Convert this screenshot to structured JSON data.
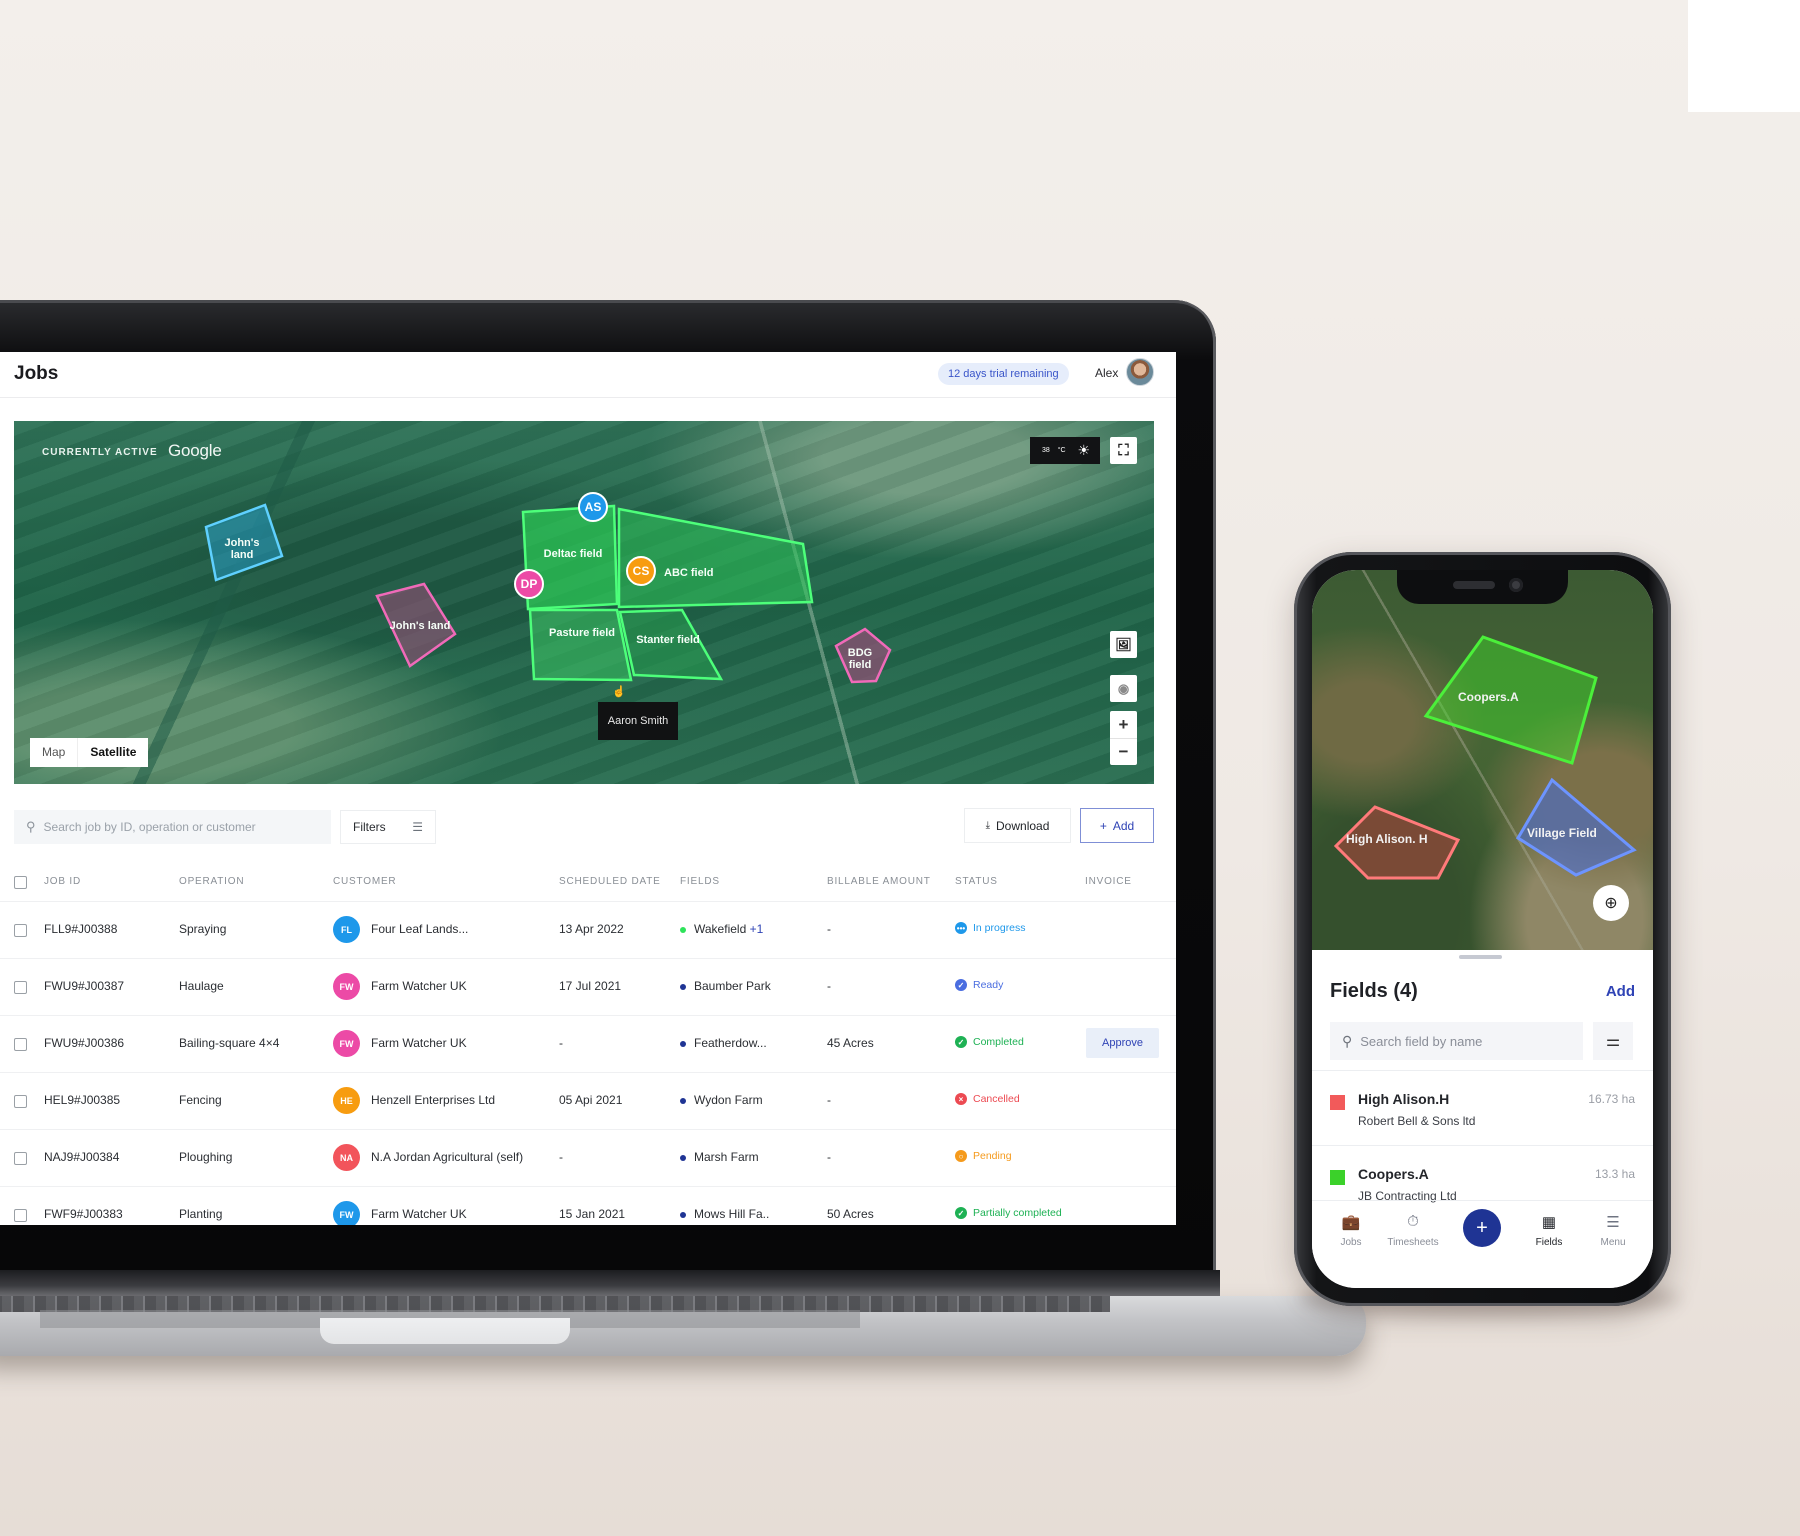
{
  "laptop": {
    "header": {
      "title": "Jobs",
      "trial_badge": "12 days trial remaining",
      "user_name": "Alex"
    },
    "map": {
      "status_label": "CURRENTLY ACTIVE",
      "provider_label": "Google",
      "weather": {
        "temperature": "38",
        "unit": "°C",
        "icon": "sun-icon"
      },
      "map_types": [
        "Map",
        "Satellite"
      ],
      "selected_map_type": "Satellite",
      "fields": [
        {
          "name": "John's land",
          "color": "#29a8e0",
          "label_lines": [
            "John's",
            "land"
          ]
        },
        {
          "name": "John's land",
          "color": "#e0479c",
          "label_lines": [
            "John's land"
          ]
        },
        {
          "name": "Deltac field",
          "color": "#2ee35a",
          "label_lines": [
            "Deltac field"
          ]
        },
        {
          "name": "ABC field",
          "color": "#2ee35a",
          "label_lines": [
            "ABC field"
          ]
        },
        {
          "name": "Pasture field",
          "color": "#2ee35a",
          "label_lines": [
            "Pasture field"
          ]
        },
        {
          "name": "Stanter field",
          "color": "#2ee35a",
          "label_lines": [
            "Stanter field"
          ]
        },
        {
          "name": "BDG field",
          "color": "#e0479c",
          "label_lines": [
            "BDG",
            "field"
          ]
        }
      ],
      "markers": [
        {
          "initials": "AS",
          "color": "#1e98ea"
        },
        {
          "initials": "DP",
          "color": "#ec4aa6"
        },
        {
          "initials": "CS",
          "color": "#f79c10"
        }
      ],
      "tooltip": "Aaron Smith",
      "controls": {
        "zoom_in": "+",
        "zoom_out": "−"
      }
    },
    "toolbar": {
      "search_placeholder": "Search job by ID, operation or customer",
      "filters_label": "Filters",
      "download_label": "Download",
      "add_label": "Add"
    },
    "table": {
      "columns": [
        "JOB ID",
        "OPERATION",
        "CUSTOMER",
        "SCHEDULED DATE",
        "FIELDS",
        "BILLABLE AMOUNT",
        "STATUS",
        "INVOICE"
      ],
      "rows": [
        {
          "job_id": "FLL9#J00388",
          "operation": "Spraying",
          "customer_initials": "FL",
          "customer_color": "#1e98ea",
          "customer": "Four Leaf Lands...",
          "date": "13 Apr 2022",
          "field": "Wakefield",
          "field_extra": "+1",
          "field_dot": "#2ee35a",
          "billable": "-",
          "status": "In progress",
          "status_color": "#1e98ea",
          "status_icon": "•••",
          "invoice": ""
        },
        {
          "job_id": "FWU9#J00387",
          "operation": "Haulage",
          "customer_initials": "FW",
          "customer_color": "#ec4aa6",
          "customer": "Farm Watcher UK",
          "date": "17 Jul 2021",
          "field": "Baumber Park",
          "field_extra": "",
          "field_dot": "#1f3494",
          "billable": "-",
          "status": "Ready",
          "status_color": "#4a6de0",
          "status_icon": "✓",
          "invoice": ""
        },
        {
          "job_id": "FWU9#J00386",
          "operation": "Bailing-square 4×4",
          "customer_initials": "FW",
          "customer_color": "#ec4aa6",
          "customer": "Farm Watcher UK",
          "date": "-",
          "field": "Featherdow...",
          "field_extra": "",
          "field_dot": "#1f3494",
          "billable": "45 Acres",
          "status": "Completed",
          "status_color": "#1eb154",
          "status_icon": "✓",
          "invoice": "Approve"
        },
        {
          "job_id": "HEL9#J00385",
          "operation": "Fencing",
          "customer_initials": "HE",
          "customer_color": "#f79c10",
          "customer": "Henzell Enterprises Ltd",
          "date": "05 Api 2021",
          "field": "Wydon Farm",
          "field_extra": "",
          "field_dot": "#1f3494",
          "billable": "-",
          "status": "Cancelled",
          "status_color": "#ec4a52",
          "status_icon": "×",
          "invoice": ""
        },
        {
          "job_id": "NAJ9#J00384",
          "operation": "Ploughing",
          "customer_initials": "NA",
          "customer_color": "#f2545b",
          "customer": "N.A Jordan Agricultural (self)",
          "date": "-",
          "field": "Marsh Farm",
          "field_extra": "",
          "field_dot": "#1f3494",
          "billable": "-",
          "status": "Pending",
          "status_color": "#f59a1c",
          "status_icon": "○",
          "invoice": ""
        },
        {
          "job_id": "FWF9#J00383",
          "operation": "Planting",
          "customer_initials": "FW",
          "customer_color": "#1e98ea",
          "customer": "Farm Watcher UK",
          "date": "15 Jan 2021",
          "field": "Mows Hill Fa..",
          "field_extra": "",
          "field_dot": "#1f3494",
          "billable": "50 Acres",
          "status": "Partially completed",
          "status_color": "#1eb154",
          "status_icon": "✓",
          "invoice": ""
        }
      ]
    }
  },
  "phone": {
    "map_fields": [
      {
        "name": "Coopers.A",
        "color": "#3fe02a"
      },
      {
        "name": "High Alison. H",
        "color": "#f25a5a"
      },
      {
        "name": "Village Field",
        "color": "#3d6cf0"
      }
    ],
    "sheet": {
      "title": "Fields (4)",
      "add_label": "Add",
      "search_placeholder": "Search field by name",
      "fields": [
        {
          "name": "High Alison.H",
          "owner": "Robert Bell & Sons ltd",
          "area": "16.73 ha",
          "color": "#f25a5a"
        },
        {
          "name": "Coopers.A",
          "owner": "JB Contracting Ltd",
          "area": "13.3 ha",
          "color": "#3bd12a"
        }
      ]
    },
    "tabs": [
      {
        "label": "Jobs",
        "icon": "briefcase-icon",
        "active": false
      },
      {
        "label": "Timesheets",
        "icon": "stopwatch-icon",
        "active": false
      },
      {
        "label": "Fields",
        "icon": "fields-icon",
        "active": true
      },
      {
        "label": "Menu",
        "icon": "menu-icon",
        "active": false
      }
    ],
    "fab_label": "+"
  },
  "colors": {
    "accent": "#2f43b5",
    "brand_dark": "#1f3494",
    "background": "#f3efeb"
  }
}
